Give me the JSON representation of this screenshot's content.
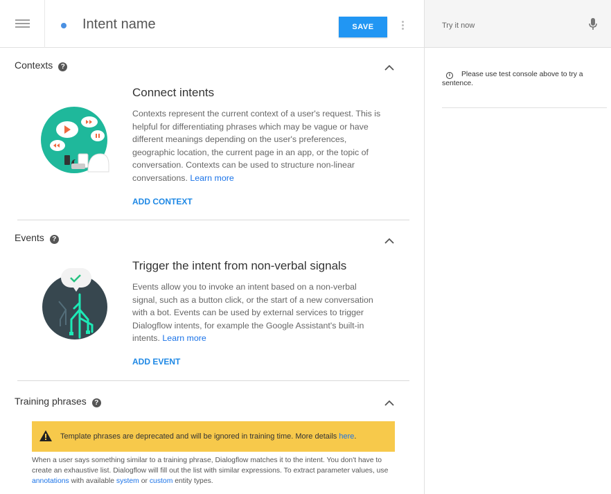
{
  "header": {
    "intent_name": "Intent name",
    "save_label": "SAVE"
  },
  "contexts": {
    "title": "Contexts",
    "help": "?",
    "heading": "Connect intents",
    "text": "Contexts represent the current context of a user's request. This is helpful for differentiating phrases which may be vague or have different meanings depending on the user's preferences, geographic location, the current page in an app, or the topic of conversation. Contexts can be used to structure non-linear conversations.",
    "learn_more": "Learn more",
    "add_label": "ADD CONTEXT"
  },
  "events": {
    "title": "Events",
    "help": "?",
    "heading": "Trigger the intent from non-verbal signals",
    "text": "Events allow you to invoke an intent based on a non-verbal signal, such as a button click, or the start of a new conversation with a bot. Events can be used by external services to trigger Dialogflow intents, for example the Google Assistant's built-in intents.",
    "learn_more": "Learn more",
    "add_label": "ADD EVENT"
  },
  "training": {
    "title": "Training phrases",
    "help": "?",
    "warning_text": "Template phrases are deprecated and will be ignored in training time. More details",
    "warning_link": "here",
    "desc_1": "When a user says something similar to a training phrase, Dialogflow matches it to the intent. You don't have to create an exhaustive list. Dialogflow will fill out the list with similar expressions. To extract parameter values, use",
    "annotations_link": "annotations",
    "desc_2": "with available",
    "system_link": "system",
    "desc_3": "or",
    "custom_link": "custom",
    "desc_4": "entity types."
  },
  "console": {
    "placeholder": "Try it now",
    "info": "Please use test console above to try a sentence."
  },
  "colors": {
    "accent": "#2196f3",
    "warning": "#f7c94b",
    "link": "#1a73e8"
  }
}
